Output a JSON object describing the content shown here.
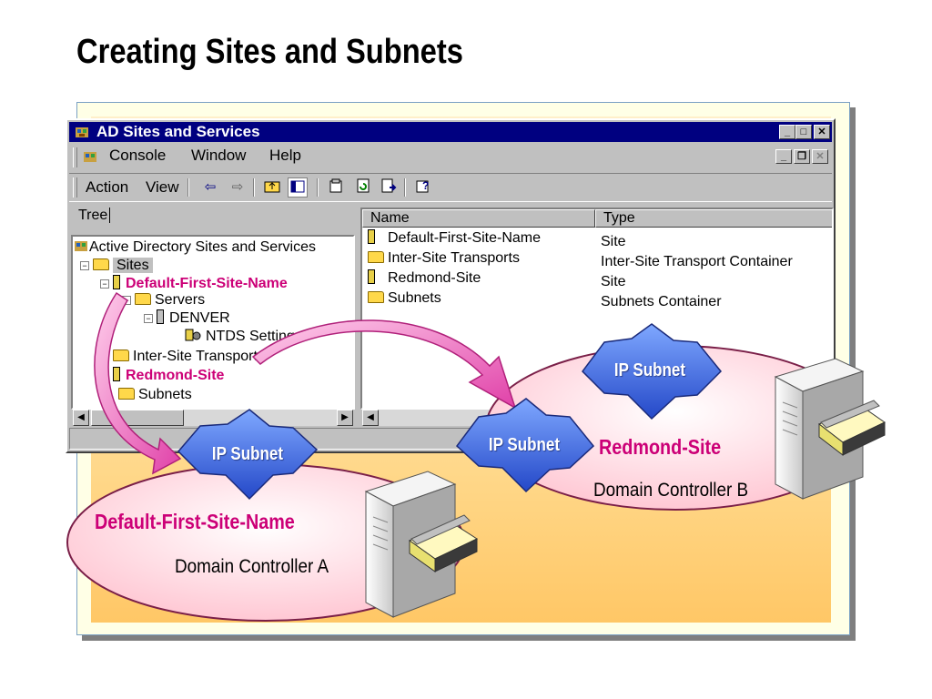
{
  "slide": {
    "title": "Creating Sites and Subnets"
  },
  "window": {
    "title": "AD Sites and Services",
    "menu": {
      "console": "Console",
      "window": "Window",
      "help": "Help"
    },
    "toolbar": {
      "action": "Action",
      "view": "View"
    },
    "tree_header": "Tree",
    "tree": {
      "root": "Active Directory Sites and Services",
      "sites": "Sites",
      "default_site": "Default-First-Site-Name",
      "servers": "Servers",
      "denver": "DENVER",
      "ntds": "NTDS Settings",
      "inter_site": "Inter-Site Transports",
      "redmond": "Redmond-Site",
      "subnets": "Subnets"
    },
    "list_headers": {
      "name": "Name",
      "type": "Type"
    },
    "list_rows": [
      {
        "name": "Default-First-Site-Name",
        "type": "Site"
      },
      {
        "name": "Inter-Site Transports",
        "type": "Inter-Site Transport Container"
      },
      {
        "name": "Redmond-Site",
        "type": "Site"
      },
      {
        "name": "Subnets",
        "type": "Subnets Container"
      }
    ]
  },
  "diagram": {
    "subnet_label": "IP Subnet",
    "site_a": {
      "name": "Default-First-Site-Name",
      "controller": "Domain Controller A"
    },
    "site_b": {
      "name": "Redmond-Site",
      "controller": "Domain Controller B"
    }
  },
  "colors": {
    "highlight": "#cc0077",
    "titlebar": "#000080",
    "subnet": "#3f6fe0",
    "ellipse": "#ffd6df"
  }
}
